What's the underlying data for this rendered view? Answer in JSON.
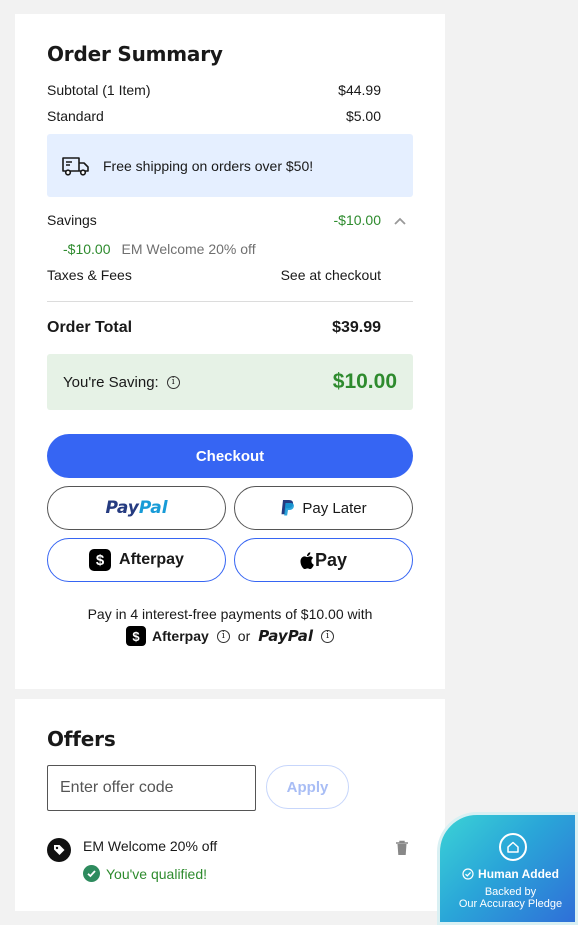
{
  "order_summary": {
    "title": "Order Summary",
    "subtotal_label": "Subtotal (1 Item)",
    "subtotal_value": "$44.99",
    "shipping_label": "Standard",
    "shipping_value": "$5.00",
    "free_shipping_message": "Free shipping on orders over $50!",
    "savings_label": "Savings",
    "savings_value": "-$10.00",
    "discount_amount": "-$10.00",
    "discount_name": "EM Welcome 20% off",
    "taxes_label": "Taxes & Fees",
    "taxes_value": "See at checkout",
    "total_label": "Order Total",
    "total_value": "$39.99",
    "saving_label": "You're Saving:",
    "saving_value": "$10.00"
  },
  "payments": {
    "checkout_label": "Checkout",
    "paypal_pay": "Pay",
    "paypal_pal": "Pal",
    "paypal_later_label": "Pay Later",
    "afterpay_label": "Afterpay",
    "apple_pay_label": "Pay",
    "installments_text": "Pay in 4 interest-free payments of $10.00 with",
    "installments_or": "or",
    "installments_afterpay": "Afterpay",
    "installments_paypal": "PayPal"
  },
  "offers": {
    "title": "Offers",
    "input_placeholder": "Enter offer code",
    "input_value": "",
    "apply_label": "Apply",
    "applied_offer_name": "EM Welcome 20% off",
    "qualified_text": "You've qualified!"
  },
  "pledge_badge": {
    "line1": "Human Added",
    "line2": "Backed by",
    "line3": "Our Accuracy Pledge"
  },
  "colors": {
    "primary_blue": "#3665f3",
    "savings_green": "#2e8b2e",
    "shipping_bg": "#e5efff",
    "saving_bg": "#e6f2e6"
  }
}
